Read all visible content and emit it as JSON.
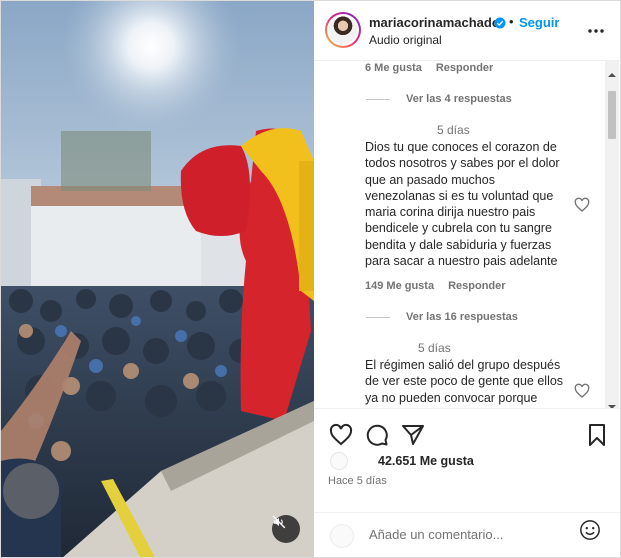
{
  "colors": {
    "link_blue": "#0095f6",
    "text": "#262626",
    "secondary": "#737373"
  },
  "media": {
    "mute_icon": "speaker-muted-icon"
  },
  "header": {
    "username": "mariacorinamachado",
    "separator": "•",
    "follow_label": "Seguir",
    "audio_label": "Audio original",
    "more_icon": "more-horizontal-icon"
  },
  "comments": {
    "top_meta": {
      "likes": "6 Me gusta",
      "reply": "Responder"
    },
    "top_view_replies": "Ver las 4 respuestas",
    "items": [
      {
        "time": "5 días",
        "text": "Dios tu que conoces el corazon de\ntodos nosotros y sabes por el dolor\nque an pasado muchos\nvenezolanas si es tu voluntad que\nmaria corina dirija nuestro pais\nbendicele y cubrela con tu sangre\nbendita y dale sabiduria y fuerzas\npara sacar a nuestro pais adelante",
        "likes": "149 Me gusta",
        "reply": "Responder",
        "view_replies": "Ver las 16 respuestas"
      },
      {
        "time": "5 días",
        "text": "El régimen salió del grupo después\nde ver este poco de gente que ellos\nya no pueden convocar porque"
      }
    ]
  },
  "actions": {
    "like_icon": "heart-icon",
    "comment_icon": "comment-icon",
    "share_icon": "send-icon",
    "save_icon": "bookmark-icon",
    "likes_count": "42.651 Me gusta",
    "posted": "Hace 5 días"
  },
  "add_comment": {
    "placeholder": "Añade un comentario...",
    "emoji_icon": "emoji-icon"
  }
}
